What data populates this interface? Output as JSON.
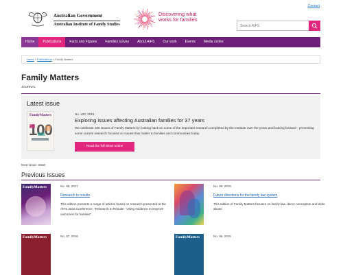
{
  "header": {
    "contact_label": "Contact",
    "gov_line1": "Australian Government",
    "gov_line2": "Australian Institute of Family Studies",
    "tagline_line1": "Discovering what",
    "tagline_line2": "works for families",
    "search_placeholder": "Search AIFS",
    "brand_color": "#6d2077",
    "accent_color": "#e2287e"
  },
  "nav": {
    "items": [
      "Home",
      "Publications",
      "Facts and Figures",
      "Families survey",
      "About AIFS",
      "Our work",
      "Events",
      "Media centre"
    ],
    "active": "Publications"
  },
  "breadcrumb": {
    "home": "Home",
    "sep": "»",
    "publications": "Publications",
    "current": "Family Matters"
  },
  "page": {
    "title": "Family Matters",
    "subtitle": "JOURNAL"
  },
  "latest": {
    "heading": "Latest issue",
    "cover_brand": "FamilyMatters",
    "cover_number": "100",
    "number": "No. 100, 2018",
    "title": "Exploring issues affecting Australian families for 37 years",
    "description": "We celebrate 100 issues of Family Matters by looking back on some of the important research completed by the Institute over the years and looking forward - presenting some current research focused on issues that matter to families and communities today.",
    "button": "Read the full issue online"
  },
  "next_issue": "Next issue: 2018",
  "previous": {
    "heading": "Previous Issues",
    "items": [
      {
        "number": "No. 99, 2017",
        "title": "Research to results",
        "description": "This edition presents a range of articles based on research presented at the AIFS 2016 Conference, \"Research to Results - Using evidence to improve outcomes for families\".",
        "cover_label": "FamilyMatters"
      },
      {
        "number": "No. 98, 2016",
        "title": "Future directions for the family law system",
        "description": "This edition of Family Matters focuses on family law, donor conception and elder abuse.",
        "cover_label": ""
      },
      {
        "number": "No. 97, 2016",
        "title": "",
        "description": "",
        "cover_label": "FamilyMatters"
      },
      {
        "number": "No. 96, 2015",
        "title": "",
        "description": "",
        "cover_label": "FamilyMatters"
      }
    ]
  }
}
